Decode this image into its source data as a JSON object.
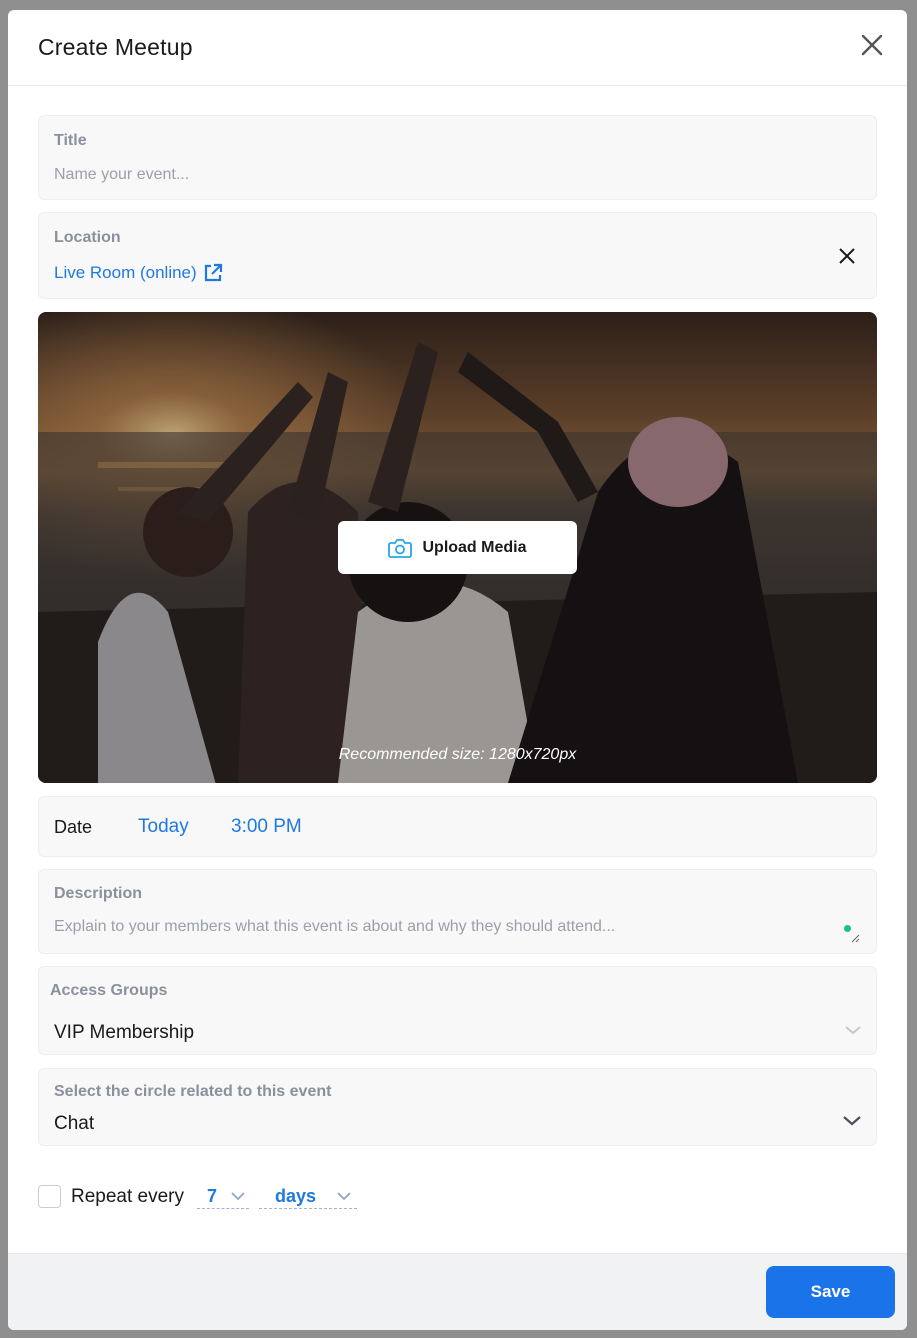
{
  "modal": {
    "title": "Create Meetup"
  },
  "title_field": {
    "label": "Title",
    "placeholder": "Name your event..."
  },
  "location_field": {
    "label": "Location",
    "value": "Live Room (online)"
  },
  "media": {
    "upload_label": "Upload Media",
    "recommended": "Recommended size: 1280x720px"
  },
  "date_field": {
    "label": "Date",
    "day": "Today",
    "time": "3:00 PM"
  },
  "description_field": {
    "label": "Description",
    "placeholder": "Explain to your members what this event is about and why they should attend..."
  },
  "access_groups": {
    "label": "Access Groups",
    "value": "VIP Membership"
  },
  "circle_select": {
    "label": "Select the circle related to this event",
    "value": "Chat"
  },
  "repeat": {
    "label": "Repeat every",
    "count": "7",
    "unit": "days",
    "checked": false
  },
  "footer": {
    "save_label": "Save"
  },
  "colors": {
    "accent": "#1a73e8",
    "link": "#1f7ae0",
    "field_bg": "#f8f8f9"
  },
  "icons": [
    "close-icon",
    "external-link-icon",
    "camera-icon",
    "chevron-down-icon",
    "resize-handle-icon"
  ]
}
